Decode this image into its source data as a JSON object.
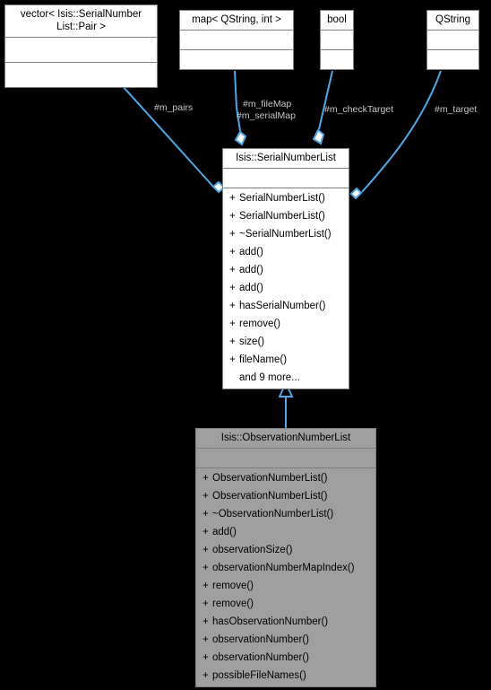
{
  "diagram": {
    "type": "uml-class-diagram",
    "background_color": "#000000",
    "edge_color": "#4ea8e8",
    "box_border_color": "#7f7f7f",
    "box_fill_color": "#ffffff",
    "highlight_fill_color": "#9f9f9f",
    "label_color": "#c8c8c8"
  },
  "classes": {
    "vector_pair": {
      "title": "vector< Isis::SerialNumber List::Pair >",
      "title_line1": "vector< Isis::SerialNumber",
      "title_line2": "List::Pair >",
      "attributes": [],
      "operations": []
    },
    "map_qstring_int": {
      "title": "map< QString, int >",
      "attributes": [],
      "operations": []
    },
    "bool_type": {
      "title": "bool",
      "attributes": [],
      "operations": []
    },
    "qstring_type": {
      "title": "QString",
      "attributes": [],
      "operations": []
    },
    "serial_number_list": {
      "title": "Isis::SerialNumberList",
      "attributes": [],
      "operations": [
        {
          "visibility": "+",
          "name": "SerialNumberList()"
        },
        {
          "visibility": "+",
          "name": "SerialNumberList()"
        },
        {
          "visibility": "+",
          "name": "~SerialNumberList()"
        },
        {
          "visibility": "+",
          "name": "add()"
        },
        {
          "visibility": "+",
          "name": "add()"
        },
        {
          "visibility": "+",
          "name": "add()"
        },
        {
          "visibility": "+",
          "name": "hasSerialNumber()"
        },
        {
          "visibility": "+",
          "name": "remove()"
        },
        {
          "visibility": "+",
          "name": "size()"
        },
        {
          "visibility": "+",
          "name": "fileName()"
        }
      ],
      "more_label": "and 9 more..."
    },
    "observation_number_list": {
      "title": "Isis::ObservationNumberList",
      "attributes": [],
      "operations": [
        {
          "visibility": "+",
          "name": "ObservationNumberList()"
        },
        {
          "visibility": "+",
          "name": "ObservationNumberList()"
        },
        {
          "visibility": "+",
          "name": "~ObservationNumberList()"
        },
        {
          "visibility": "+",
          "name": "add()"
        },
        {
          "visibility": "+",
          "name": "observationSize()"
        },
        {
          "visibility": "+",
          "name": "observationNumberMapIndex()"
        },
        {
          "visibility": "+",
          "name": "remove()"
        },
        {
          "visibility": "+",
          "name": "remove()"
        },
        {
          "visibility": "+",
          "name": "hasObservationNumber()"
        },
        {
          "visibility": "+",
          "name": "observationNumber()"
        },
        {
          "visibility": "+",
          "name": "observationNumber()"
        },
        {
          "visibility": "+",
          "name": "possibleFileNames()"
        }
      ]
    }
  },
  "relations": [
    {
      "id": "pairs",
      "label": "#m_pairs",
      "kind": "aggregation",
      "from": "vector_pair",
      "to": "serial_number_list"
    },
    {
      "id": "filemap",
      "label": "#m_fileMap",
      "kind": "aggregation",
      "from": "map_qstring_int",
      "to": "serial_number_list"
    },
    {
      "id": "serialmap",
      "label": "#m_serialMap",
      "kind": "aggregation",
      "from": "map_qstring_int",
      "to": "serial_number_list"
    },
    {
      "id": "checktarget",
      "label": "#m_checkTarget",
      "kind": "aggregation",
      "from": "bool_type",
      "to": "serial_number_list"
    },
    {
      "id": "target",
      "label": "#m_target",
      "kind": "aggregation",
      "from": "qstring_type",
      "to": "serial_number_list"
    },
    {
      "id": "inheritance",
      "label": "",
      "kind": "inheritance",
      "from": "observation_number_list",
      "to": "serial_number_list"
    }
  ]
}
